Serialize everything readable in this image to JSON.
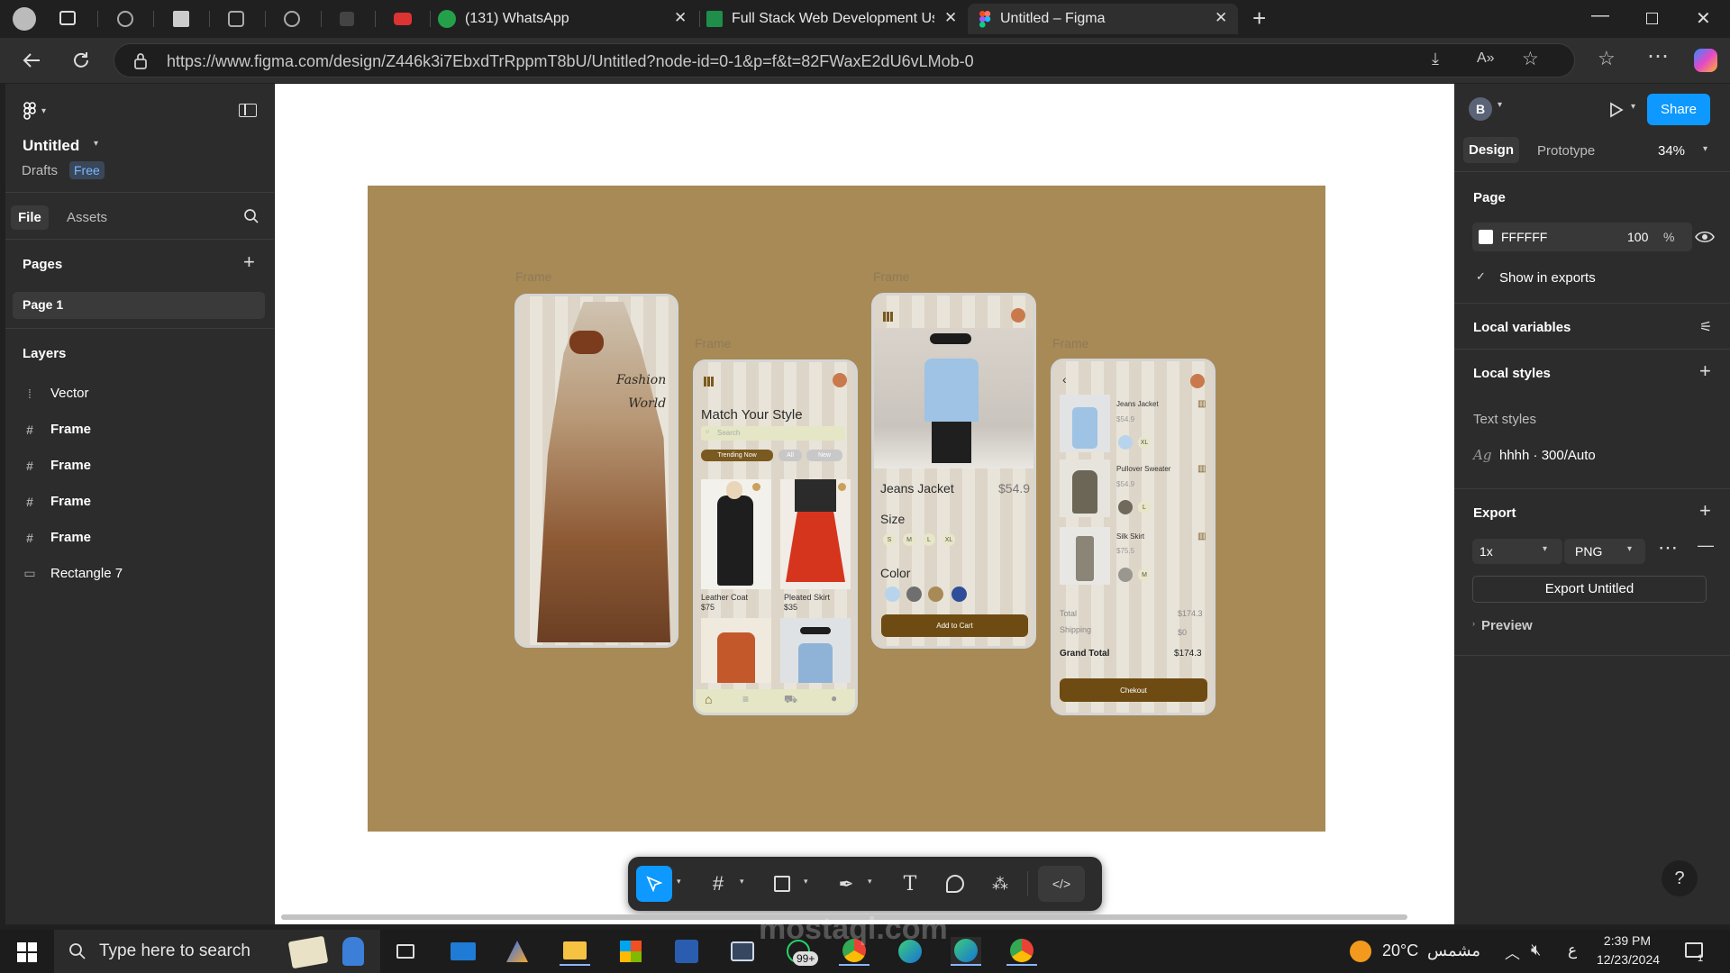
{
  "browser": {
    "tabs": [
      {
        "title": "(131) WhatsApp"
      },
      {
        "title": "Full Stack Web Development Usin"
      },
      {
        "title": "Untitled – Figma"
      }
    ],
    "url": "https://www.figma.com/design/Z446k3i7EbxdTrRppmT8bU/Untitled?node-id=0-1&p=f&t=82FWaxE2dU6vLMob-0"
  },
  "left_panel": {
    "file_name": "Untitled",
    "drafts": "Drafts",
    "plan_badge": "Free",
    "tabs": {
      "file": "File",
      "assets": "Assets"
    },
    "pages_title": "Pages",
    "page_item": "Page 1",
    "layers_title": "Layers",
    "layers": [
      {
        "name": "Vector",
        "icon": "vector-icon"
      },
      {
        "name": "Frame",
        "icon": "frame-icon"
      },
      {
        "name": "Frame",
        "icon": "frame-icon"
      },
      {
        "name": "Frame",
        "icon": "frame-icon"
      },
      {
        "name": "Frame",
        "icon": "frame-icon"
      },
      {
        "name": "Rectangle 7",
        "icon": "rectangle-icon"
      }
    ]
  },
  "right_panel": {
    "avatar_letter": "B",
    "share": "Share",
    "tabs": {
      "design": "Design",
      "prototype": "Prototype"
    },
    "zoom": "34%",
    "page_title": "Page",
    "page_color": "FFFFFF",
    "page_opacity": "100",
    "percent": "%",
    "show_in_exports": "Show in exports",
    "local_variables": "Local variables",
    "local_styles": "Local styles",
    "text_styles": "Text styles",
    "text_style_sample": "Ag",
    "text_style_name": "hhhh · 300/Auto",
    "export_title": "Export",
    "export_scale": "1x",
    "export_format": "PNG",
    "export_button": "Export Untitled",
    "preview": "Preview"
  },
  "canvas": {
    "frame_label": "Frame",
    "screen1": {
      "brand_line1": "Fashion",
      "brand_line2": "World"
    },
    "screen2": {
      "title": "Match Your Style",
      "search_placeholder": "Search",
      "chips": [
        "Trending Now",
        "All",
        "New"
      ],
      "products": [
        {
          "name": "Leather Coat",
          "price": "$75"
        },
        {
          "name": "Pleated Skirt",
          "price": "$35"
        }
      ]
    },
    "screen3": {
      "name": "Jeans Jacket",
      "price": "$54.9",
      "size_label": "Size",
      "sizes": [
        "S",
        "M",
        "L",
        "XL"
      ],
      "color_label": "Color",
      "colors": [
        "#b8d4ec",
        "#6f6f6f",
        "#a88a57",
        "#2f4e9a"
      ],
      "cta": "Add to Cart"
    },
    "screen4": {
      "items": [
        {
          "name": "Jeans Jacket",
          "price": "$54.9",
          "size": "XL",
          "swatch": "#b8d4ec"
        },
        {
          "name": "Pullover Sweater",
          "price": "$54.9",
          "size": "L",
          "swatch": "#6f6a5c"
        },
        {
          "name": "Silk Skirt",
          "price": "$75.5",
          "size": "M",
          "swatch": "#9a9690"
        }
      ],
      "total_label": "Total",
      "total": "$174.3",
      "shipping_label": "Shipping",
      "shipping": "$0",
      "grand_label": "Grand Total",
      "grand": "$174.3",
      "cta": "Chekout"
    }
  },
  "taskbar": {
    "search_placeholder": "Type here to search",
    "weather": "20°C",
    "weather_desc": "مشمس",
    "lang": "ع",
    "time": "2:39 PM",
    "date": "12/23/2024",
    "notif": "1",
    "whatsapp_badge": "99+"
  },
  "watermark": "mostaql.com"
}
